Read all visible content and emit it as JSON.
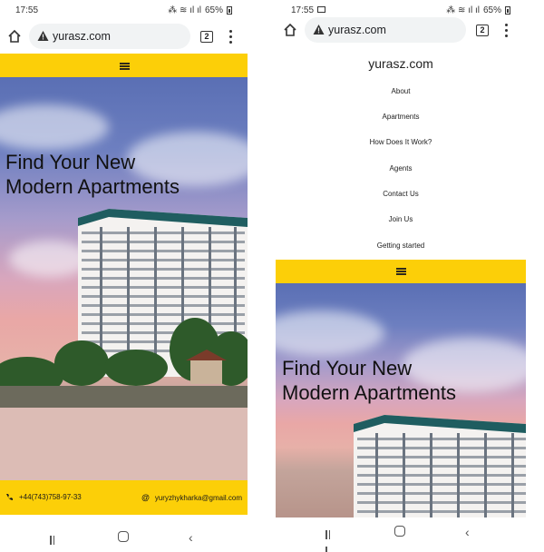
{
  "status_left": {
    "time": "17:55",
    "battery": "65%"
  },
  "status_right": {
    "time": "17:55",
    "battery": "65%"
  },
  "browser": {
    "url": "yurasz.com",
    "tab_count": "2"
  },
  "hero": {
    "line1": "Find Your New",
    "line2": "Modern Apartments"
  },
  "footer": {
    "phone": "+44(743)758-97-33",
    "email": "yuryzhykharka@gmail.com"
  },
  "menu": {
    "site_title": "yurasz.com",
    "items": [
      {
        "label": "About"
      },
      {
        "label": "Apartments"
      },
      {
        "label": "How Does It Work?"
      },
      {
        "label": "Agents"
      },
      {
        "label": "Contact Us"
      },
      {
        "label": "Join Us"
      },
      {
        "label": "Getting started"
      }
    ]
  },
  "colors": {
    "accent_yellow": "#fccf08",
    "url_box": "#f1f3f4"
  },
  "icons": {
    "home": "home-icon",
    "warning": "warning-icon",
    "tabs": "tab-switcher-icon",
    "more": "more-vert-icon",
    "hamburger": "hamburger-menu-icon",
    "phone": "phone-icon",
    "email": "at-sign-icon"
  }
}
